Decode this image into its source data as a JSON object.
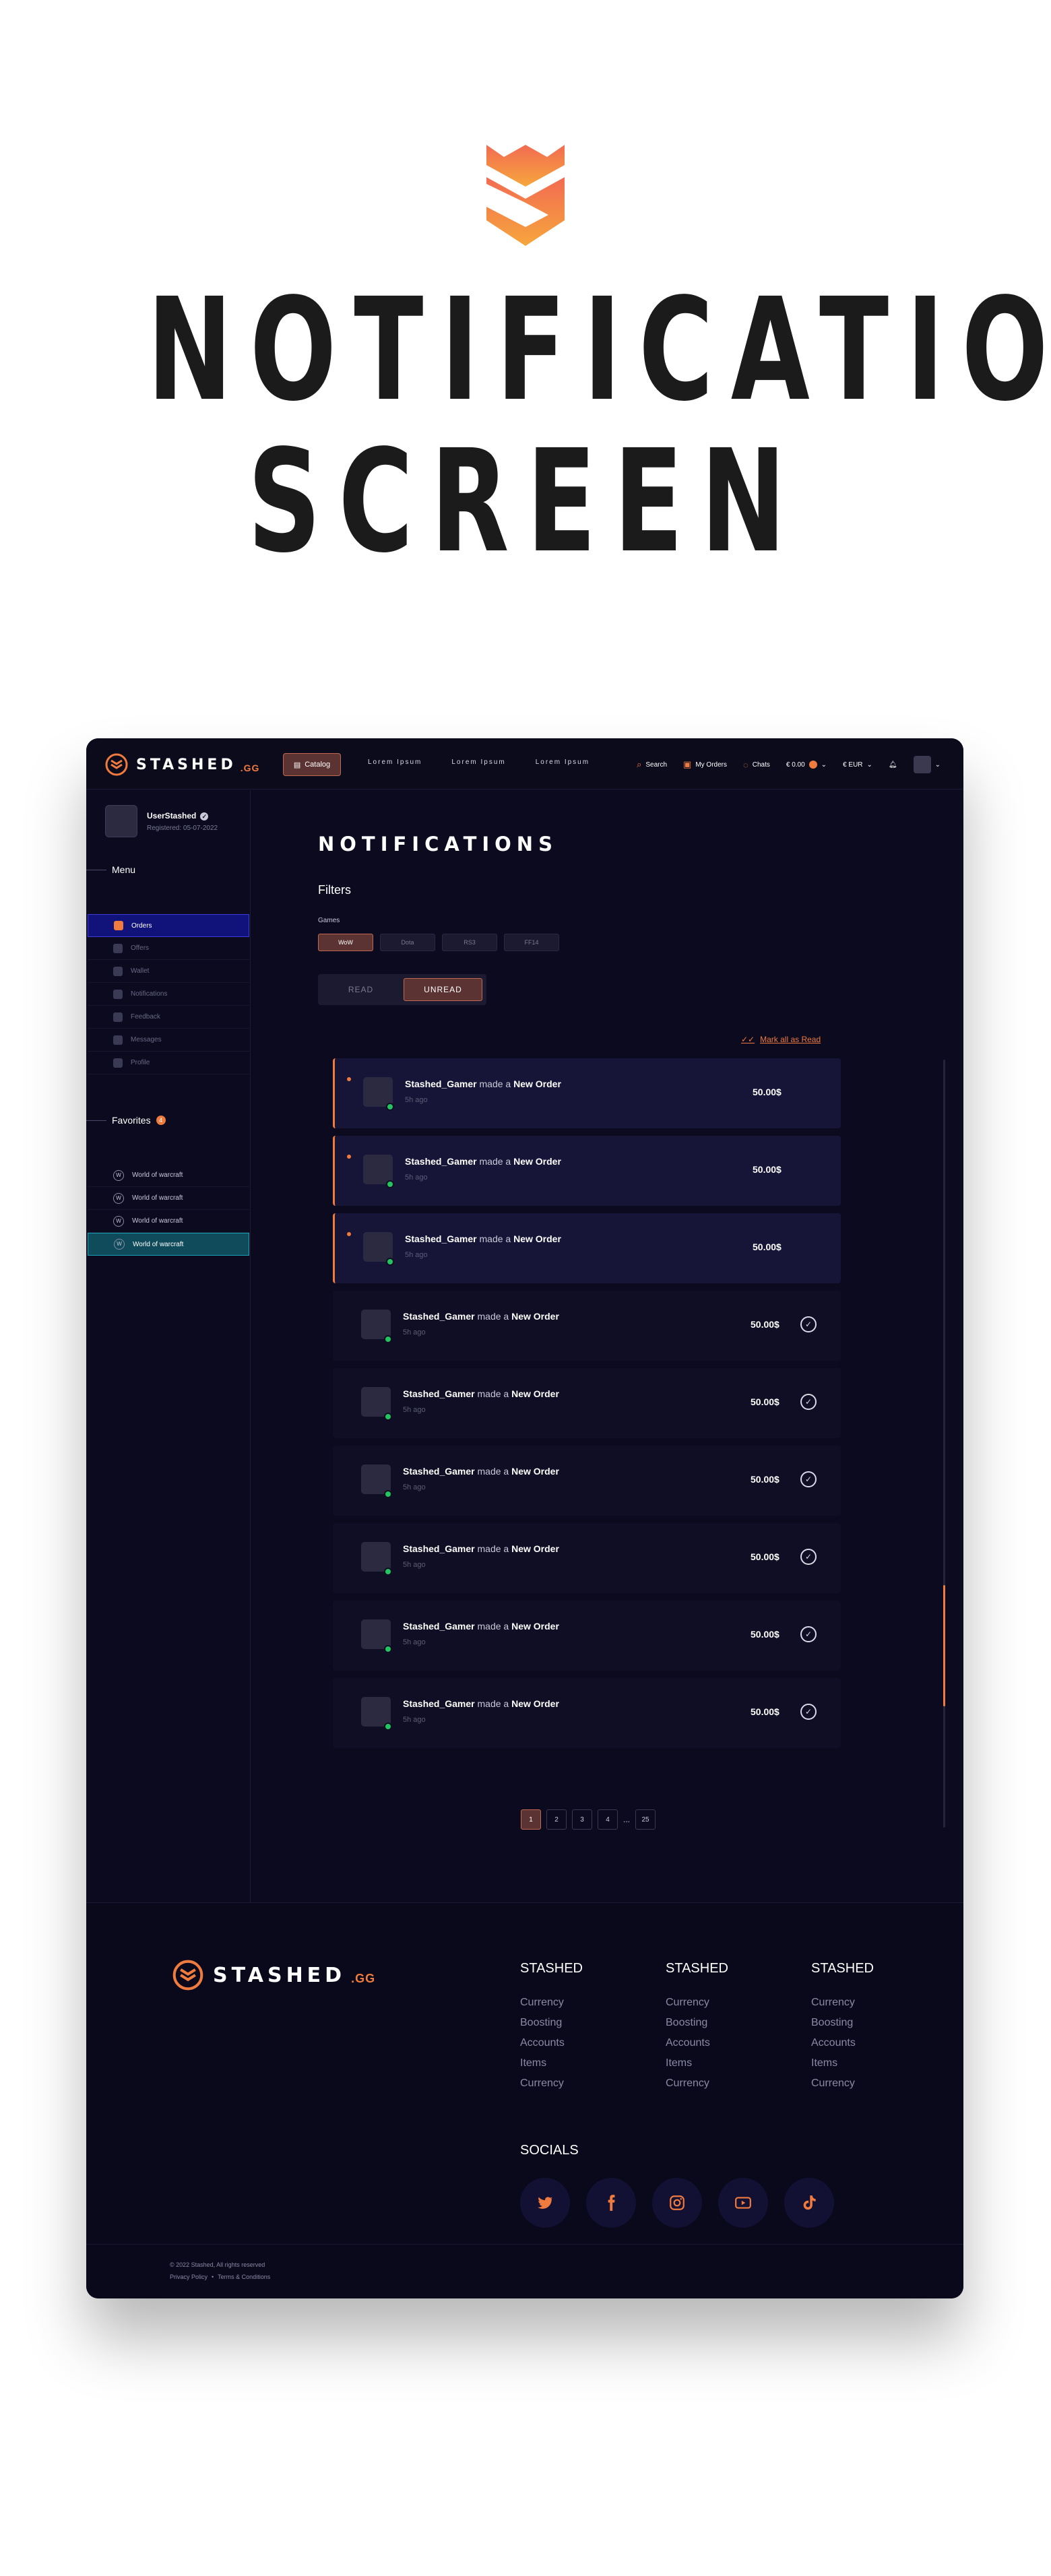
{
  "hero": {
    "title_line1": "NOTIFICATIONS",
    "title_line2": "SCREEN"
  },
  "colors": {
    "accent": "#f07b3f",
    "background": "#0b0a1f",
    "online": "#22c55e"
  },
  "topbar": {
    "brand": "STASHED",
    "brand_suffix": ".GG",
    "catalog_label": "Catalog",
    "nav": [
      "Lorem Ipsum",
      "Lorem Ipsum",
      "Lorem Ipsum"
    ],
    "search_label": "Search",
    "orders_label": "My Orders",
    "chats_label": "Chats",
    "balance": "€ 0.00",
    "currency": "€ EUR"
  },
  "sidebar": {
    "user": {
      "name": "UserStashed",
      "registered": "Registered: 05-07-2022"
    },
    "menu_title": "Menu",
    "menu": [
      {
        "label": "Orders",
        "icon": "orders-icon",
        "active": true
      },
      {
        "label": "Offers",
        "icon": "offers-icon",
        "active": false
      },
      {
        "label": "Wallet",
        "icon": "wallet-icon",
        "active": false
      },
      {
        "label": "Notifications",
        "icon": "notifications-icon",
        "active": false
      },
      {
        "label": "Feedback",
        "icon": "feedback-icon",
        "active": false
      },
      {
        "label": "Messages",
        "icon": "messages-icon",
        "active": false
      },
      {
        "label": "Profile",
        "icon": "profile-icon",
        "active": false
      }
    ],
    "favorites_title": "Favorites",
    "favorites_count": "4",
    "favorites": [
      {
        "label": "World of warcraft",
        "active": false
      },
      {
        "label": "World of warcraft",
        "active": false
      },
      {
        "label": "World of warcraft",
        "active": false
      },
      {
        "label": "World of warcraft",
        "active": true
      }
    ]
  },
  "main": {
    "title": "NOTIFICATIONS",
    "filters_title": "Filters",
    "games_label": "Games",
    "games": [
      {
        "label": "WoW",
        "active": true
      },
      {
        "label": "Dota",
        "active": false
      },
      {
        "label": "RS3",
        "active": false
      },
      {
        "label": "FF14",
        "active": false
      }
    ],
    "toggle": {
      "read": "READ",
      "unread": "UNREAD",
      "active": "unread"
    },
    "mark_all": "Mark all as Read",
    "notifications": [
      {
        "user": "Stashed_Gamer",
        "action": "made a",
        "object": "New Order",
        "time": "5h ago",
        "amount": "50.00$",
        "unread": true
      },
      {
        "user": "Stashed_Gamer",
        "action": "made a",
        "object": "New Order",
        "time": "5h ago",
        "amount": "50.00$",
        "unread": true
      },
      {
        "user": "Stashed_Gamer",
        "action": "made a",
        "object": "New Order",
        "time": "5h ago",
        "amount": "50.00$",
        "unread": true
      },
      {
        "user": "Stashed_Gamer",
        "action": "made a",
        "object": "New Order",
        "time": "5h ago",
        "amount": "50.00$",
        "unread": false
      },
      {
        "user": "Stashed_Gamer",
        "action": "made a",
        "object": "New Order",
        "time": "5h ago",
        "amount": "50.00$",
        "unread": false
      },
      {
        "user": "Stashed_Gamer",
        "action": "made a",
        "object": "New Order",
        "time": "5h ago",
        "amount": "50.00$",
        "unread": false
      },
      {
        "user": "Stashed_Gamer",
        "action": "made a",
        "object": "New Order",
        "time": "5h ago",
        "amount": "50.00$",
        "unread": false
      },
      {
        "user": "Stashed_Gamer",
        "action": "made a",
        "object": "New Order",
        "time": "5h ago",
        "amount": "50.00$",
        "unread": false
      },
      {
        "user": "Stashed_Gamer",
        "action": "made a",
        "object": "New Order",
        "time": "5h ago",
        "amount": "50.00$",
        "unread": false
      }
    ],
    "pagination": {
      "pages": [
        "1",
        "2",
        "3",
        "4"
      ],
      "ellipsis": "...",
      "last": "25",
      "current": "1"
    }
  },
  "footer": {
    "brand": "STASHED",
    "brand_suffix": ".GG",
    "columns": [
      {
        "title": "STASHED",
        "links": [
          "Currency",
          "Boosting",
          "Accounts",
          "Items",
          "Currency"
        ]
      },
      {
        "title": "STASHED",
        "links": [
          "Currency",
          "Boosting",
          "Accounts",
          "Items",
          "Currency"
        ]
      },
      {
        "title": "STASHED",
        "links": [
          "Currency",
          "Boosting",
          "Accounts",
          "Items",
          "Currency"
        ]
      }
    ],
    "socials_title": "SOCIALS",
    "socials": [
      "twitter-icon",
      "facebook-icon",
      "instagram-icon",
      "youtube-icon",
      "tiktok-icon"
    ],
    "copyright": "© 2022 Stashed, All rights reserved",
    "privacy": "Privacy Policy",
    "separator": "•",
    "terms": "Terms & Conditions"
  }
}
